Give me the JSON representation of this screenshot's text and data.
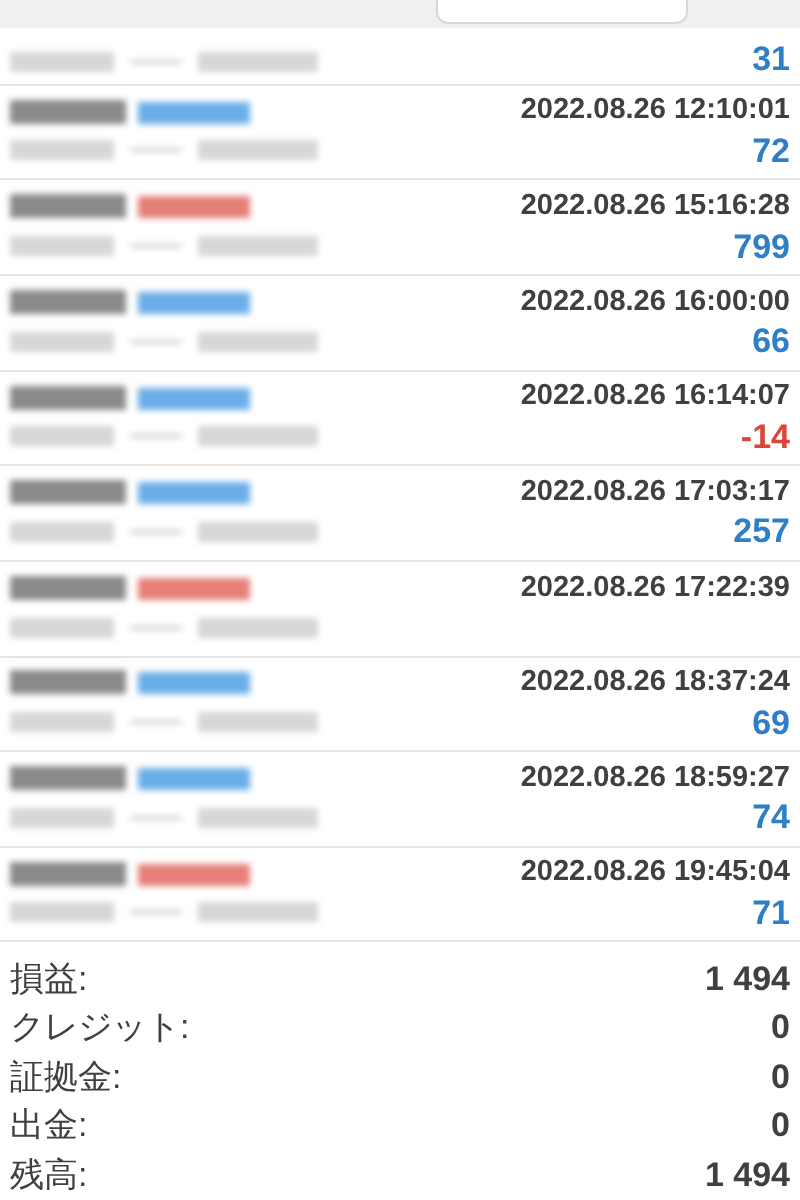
{
  "first_row": {
    "profit": "31",
    "negative": false
  },
  "orders": [
    {
      "kind": "buy",
      "time": "2022.08.26 12:10:01",
      "profit": "72",
      "negative": false
    },
    {
      "kind": "sell",
      "time": "2022.08.26 15:16:28",
      "profit": "799",
      "negative": false
    },
    {
      "kind": "buy",
      "time": "2022.08.26 16:00:00",
      "profit": "66",
      "negative": false
    },
    {
      "kind": "buy",
      "time": "2022.08.26 16:14:07",
      "profit": "-14",
      "negative": true
    },
    {
      "kind": "buy",
      "time": "2022.08.26 17:03:17",
      "profit": "257",
      "negative": false
    },
    {
      "kind": "sell",
      "time": "2022.08.26 17:22:39"
    },
    {
      "kind": "buy",
      "time": "2022.08.26 18:37:24",
      "profit": "69",
      "negative": false
    },
    {
      "kind": "buy",
      "time": "2022.08.26 18:59:27",
      "profit": "74",
      "negative": false
    },
    {
      "kind": "sell",
      "time": "2022.08.26 19:45:04",
      "profit": "71",
      "negative": false
    }
  ],
  "summary": [
    {
      "label": "損益:",
      "value": "1 494"
    },
    {
      "label": "クレジット:",
      "value": "0"
    },
    {
      "label": "証拠金:",
      "value": "0"
    },
    {
      "label": "出金:",
      "value": "0"
    },
    {
      "label": "残高:",
      "value": "1 494"
    }
  ]
}
